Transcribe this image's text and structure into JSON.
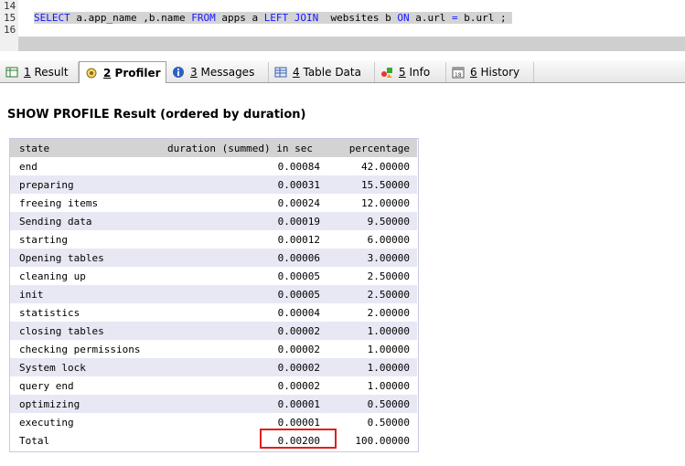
{
  "editor": {
    "lines": [
      {
        "number": "14",
        "text": ""
      },
      {
        "number": "15",
        "text": "SELECT a.app_name ,b.name FROM apps a LEFT JOIN  websites b ON a.url = b.url ;"
      },
      {
        "number": "16",
        "text": ""
      }
    ]
  },
  "tabs": [
    {
      "num": "1",
      "label": "Result",
      "icon": "result-grid-icon"
    },
    {
      "num": "2",
      "label": "Profiler",
      "icon": "profiler-icon",
      "active": true
    },
    {
      "num": "3",
      "label": "Messages",
      "icon": "info-circle-icon"
    },
    {
      "num": "4",
      "label": "Table Data",
      "icon": "table-icon"
    },
    {
      "num": "5",
      "label": "Info",
      "icon": "shapes-icon"
    },
    {
      "num": "6",
      "label": "History",
      "icon": "calendar-icon"
    }
  ],
  "result": {
    "title": "SHOW PROFILE Result (ordered by duration)",
    "columns": [
      "state",
      "duration (summed) in sec",
      "percentage"
    ],
    "rows": [
      [
        "end",
        "0.00084",
        "42.00000"
      ],
      [
        "preparing",
        "0.00031",
        "15.50000"
      ],
      [
        "freeing items",
        "0.00024",
        "12.00000"
      ],
      [
        "Sending data",
        "0.00019",
        "9.50000"
      ],
      [
        "starting",
        "0.00012",
        "6.00000"
      ],
      [
        "Opening tables",
        "0.00006",
        "3.00000"
      ],
      [
        "cleaning up",
        "0.00005",
        "2.50000"
      ],
      [
        "init",
        "0.00005",
        "2.50000"
      ],
      [
        "statistics",
        "0.00004",
        "2.00000"
      ],
      [
        "closing tables",
        "0.00002",
        "1.00000"
      ],
      [
        "checking permissions",
        "0.00002",
        "1.00000"
      ],
      [
        "System lock",
        "0.00002",
        "1.00000"
      ],
      [
        "query end",
        "0.00002",
        "1.00000"
      ],
      [
        "optimizing",
        "0.00001",
        "0.50000"
      ],
      [
        "executing",
        "0.00001",
        "0.50000"
      ]
    ],
    "total": [
      "Total",
      "0.00200",
      "100.00000"
    ]
  }
}
